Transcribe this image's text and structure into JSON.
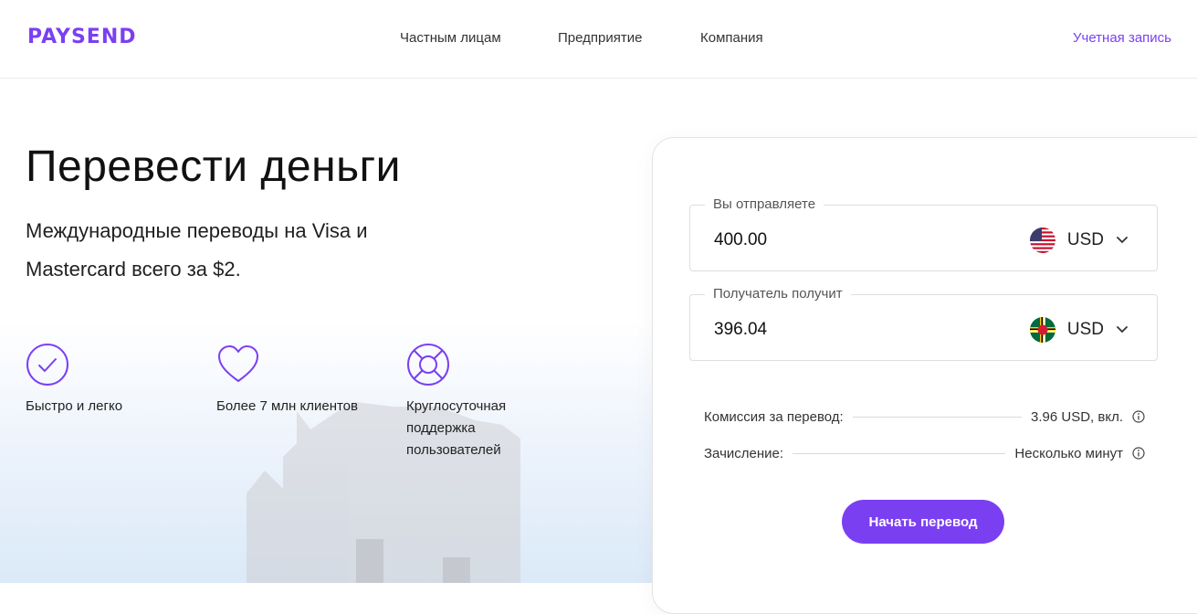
{
  "header": {
    "logo": "PAYSEND",
    "nav": [
      "Частным лицам",
      "Предприятие",
      "Компания"
    ],
    "account": "Учетная запись"
  },
  "hero": {
    "title": "Перевести деньги",
    "subtitle": "Международные переводы на Visa и Mastercard всего за $2."
  },
  "features": [
    {
      "icon": "check-circle-icon",
      "text": "Быстро и легко"
    },
    {
      "icon": "heart-icon",
      "text": "Более 7 млн клиентов"
    },
    {
      "icon": "lifebuoy-icon",
      "text": "Круглосуточная поддержка пользователей"
    }
  ],
  "calculator": {
    "send": {
      "label": "Вы отправляете",
      "amount": "400.00",
      "currency": "USD",
      "flag": "us-flag-icon"
    },
    "receive": {
      "label": "Получатель получит",
      "amount": "396.04",
      "currency": "USD",
      "flag": "dominica-flag-icon"
    },
    "fee": {
      "label": "Комиссия за перевод:",
      "value": "3.96 USD, вкл."
    },
    "delivery": {
      "label": "Зачисление:",
      "value": "Несколько минут"
    },
    "cta": "Начать перевод"
  },
  "colors": {
    "accent": "#7b3ff2"
  }
}
